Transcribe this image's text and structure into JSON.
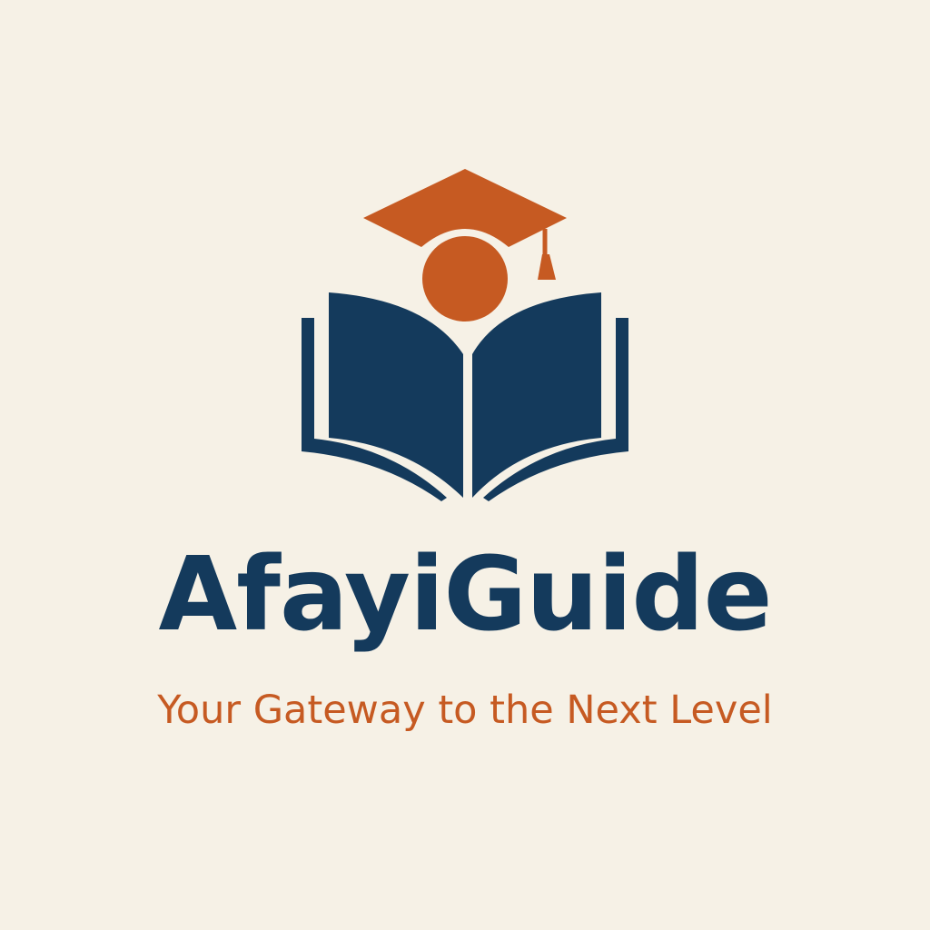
{
  "brand": {
    "name": "AfayiGuide",
    "tagline": "Your Gateway to the Next Level"
  },
  "logo": {
    "icons": [
      "graduation-cap-icon",
      "head-icon",
      "open-book-icon"
    ]
  },
  "colors": {
    "background": "#f6f1e6",
    "primary": "#143a5c",
    "accent": "#c65a22"
  }
}
